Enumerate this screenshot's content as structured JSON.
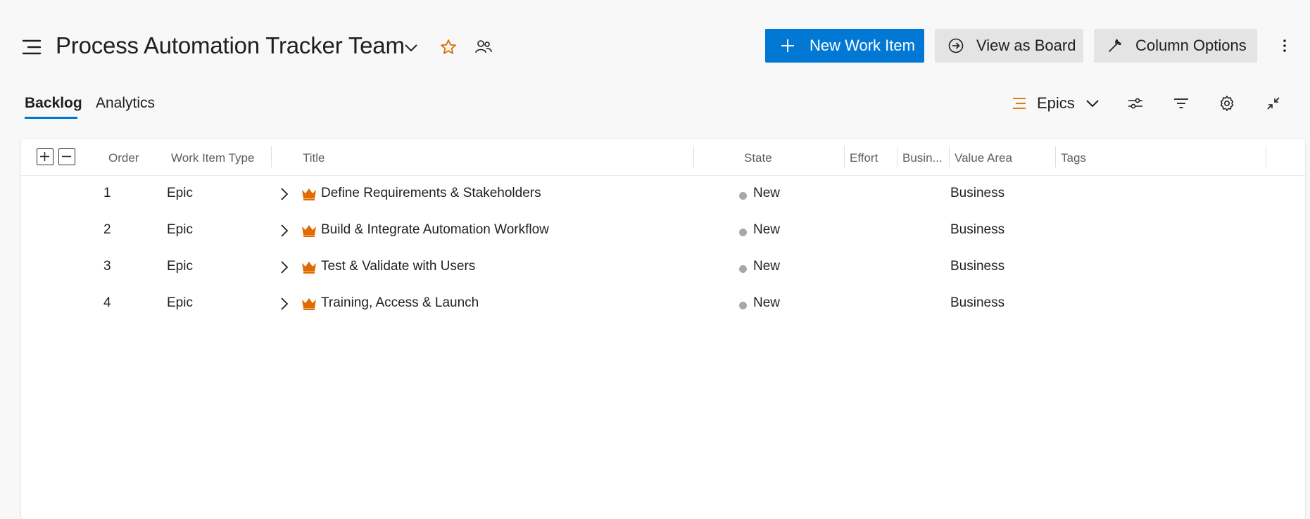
{
  "header": {
    "team_name": "Process Automation Tracker Team",
    "new_work_item_label": "New Work Item",
    "view_as_board_label": "View as Board",
    "column_options_label": "Column Options",
    "icons": [
      "hamburger-icon",
      "chevron-down-icon",
      "star-icon",
      "people-icon",
      "plus-icon",
      "circle-arrow-icon",
      "wrench-icon",
      "more-vertical-icon"
    ]
  },
  "tabs": [
    {
      "label": "Backlog",
      "selected": true
    },
    {
      "label": "Analytics",
      "selected": false
    }
  ],
  "toolbar": {
    "backlog_level": "Epics",
    "icons": [
      "backlog-level-icon",
      "view-options-icon",
      "filter-icon",
      "settings-icon",
      "collapse-icon"
    ]
  },
  "table": {
    "columns": [
      "Order",
      "Work Item Type",
      "Title",
      "State",
      "Effort",
      "Busin...",
      "Value Area",
      "Tags"
    ],
    "rows": [
      {
        "order": "1",
        "type": "Epic",
        "title": "Define Requirements & Stakeholders",
        "state": "New",
        "effort": "",
        "business_value": "",
        "value_area": "Business",
        "tags": ""
      },
      {
        "order": "2",
        "type": "Epic",
        "title": "Build & Integrate Automation Workflow",
        "state": "New",
        "effort": "",
        "business_value": "",
        "value_area": "Business",
        "tags": ""
      },
      {
        "order": "3",
        "type": "Epic",
        "title": "Test & Validate with Users",
        "state": "New",
        "effort": "",
        "business_value": "",
        "value_area": "Business",
        "tags": ""
      },
      {
        "order": "4",
        "type": "Epic",
        "title": "Training, Access & Launch",
        "state": "New",
        "effort": "",
        "business_value": "",
        "value_area": "Business",
        "tags": ""
      }
    ]
  },
  "colors": {
    "primary": "#0078d4",
    "epic_orange": "#e06c00",
    "state_new": "#a8a8a8",
    "page_bg": "#f8f8f8"
  }
}
